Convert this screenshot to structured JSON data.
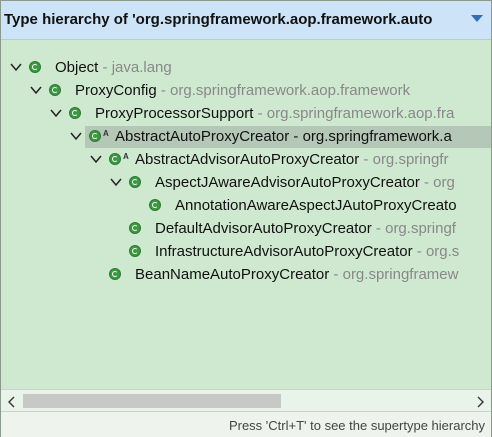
{
  "header": {
    "title": "Type hierarchy of 'org.springframework.aop.framework.auto"
  },
  "tree": {
    "rows": [
      {
        "name": "Object",
        "pkg": " - java.lang"
      },
      {
        "name": "ProxyConfig",
        "pkg": " - org.springframework.aop.framework"
      },
      {
        "name": "ProxyProcessorSupport",
        "pkg": " - org.springframework.aop.fra"
      },
      {
        "name": "AbstractAutoProxyCreator - org.springframework.a",
        "pkg": ""
      },
      {
        "name": "AbstractAdvisorAutoProxyCreator",
        "pkg": " - org.springfr"
      },
      {
        "name": "AspectJAwareAdvisorAutoProxyCreator",
        "pkg": " - org"
      },
      {
        "name": "AnnotationAwareAspectJAutoProxyCreato",
        "pkg": ""
      },
      {
        "name": "DefaultAdvisorAutoProxyCreator",
        "pkg": " - org.springf"
      },
      {
        "name": "InfrastructureAdvisorAutoProxyCreator",
        "pkg": " - org.s"
      },
      {
        "name": "BeanNameAutoProxyCreator",
        "pkg": " - org.springframew"
      }
    ],
    "abstract_marker": "A"
  },
  "status": {
    "text": "Press 'Ctrl+T' to see the supertype hierarchy"
  },
  "icons": {
    "class": "class-icon",
    "expanded": "chevron-down-icon",
    "menu": "view-menu-icon"
  }
}
